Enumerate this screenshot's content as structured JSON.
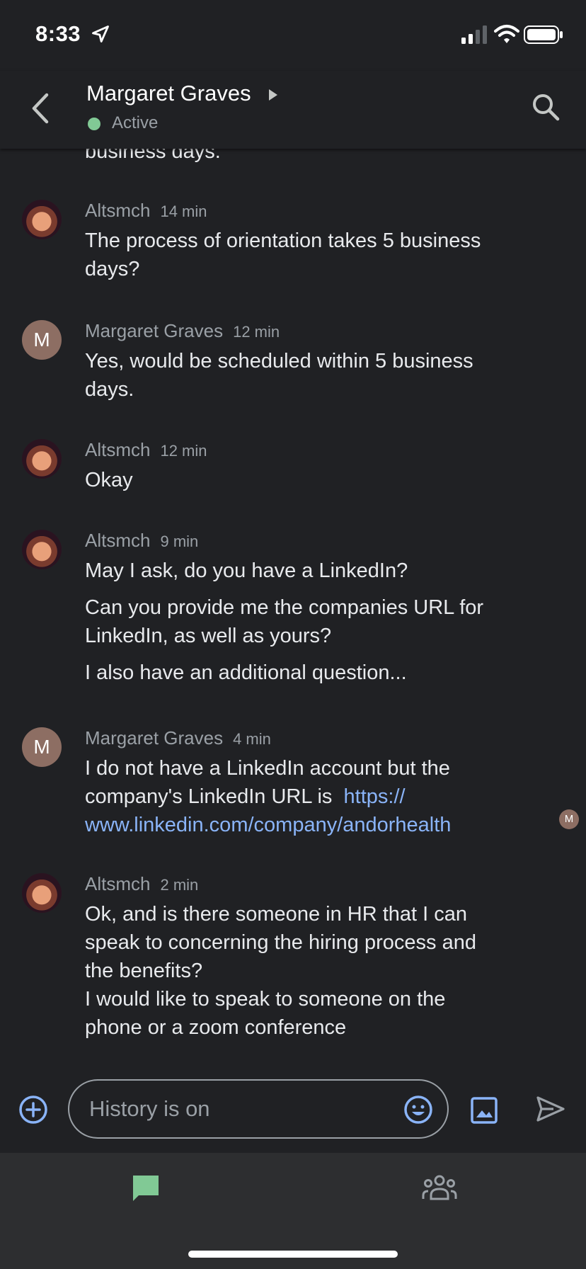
{
  "status_bar": {
    "time": "8:33"
  },
  "header": {
    "contact_name": "Margaret Graves",
    "presence": "Active"
  },
  "thread": {
    "top_fragment": "business days.",
    "messages": [
      {
        "sender": "Altsmch",
        "time": "14 min",
        "lines": [
          "The process of orientation takes 5 business",
          "days?"
        ]
      },
      {
        "sender": "Margaret Graves",
        "avatar_letter": "M",
        "time": "12 min",
        "lines": [
          "Yes, would be scheduled within 5 business",
          "days."
        ]
      },
      {
        "sender": "Altsmch",
        "time": "12 min",
        "lines": [
          "Okay"
        ]
      },
      {
        "sender": "Altsmch",
        "time": "9 min",
        "lines": [
          "May I ask, do you have a LinkedIn?",
          "Can you provide me the companies URL for",
          "LinkedIn, as well as yours?",
          "I also have an additional question..."
        ]
      },
      {
        "sender": "Margaret Graves",
        "avatar_letter": "M",
        "time": "4 min",
        "lines": [
          "I do not have a LinkedIn account but the",
          "company's LinkedIn URL is "
        ],
        "link_lines": [
          "https://",
          "www.linkedin.com/company/andorhealth"
        ]
      },
      {
        "sender": "Altsmch",
        "time": "2 min",
        "lines": [
          "Ok, and is there someone in HR that I can",
          "speak to concerning the hiring process and",
          "the benefits?",
          "I would like to speak to someone on the",
          "phone or a zoom conference"
        ]
      }
    ],
    "read_receipt_letter": "M"
  },
  "composer": {
    "placeholder": "History is on"
  },
  "colors": {
    "background": "#202124",
    "accent": "#8ab4f8",
    "active_dot": "#81c995",
    "chat_tab": "#81c995",
    "avatar_letter_bg": "#8d6e63"
  },
  "icons": [
    "location-arrow-icon",
    "signal-icon",
    "wifi-icon",
    "battery-icon",
    "back-arrow-icon",
    "caret-right-icon",
    "search-icon",
    "add-circle-icon",
    "emoji-icon",
    "image-icon",
    "send-icon",
    "chat-tab-icon",
    "rooms-tab-icon"
  ]
}
